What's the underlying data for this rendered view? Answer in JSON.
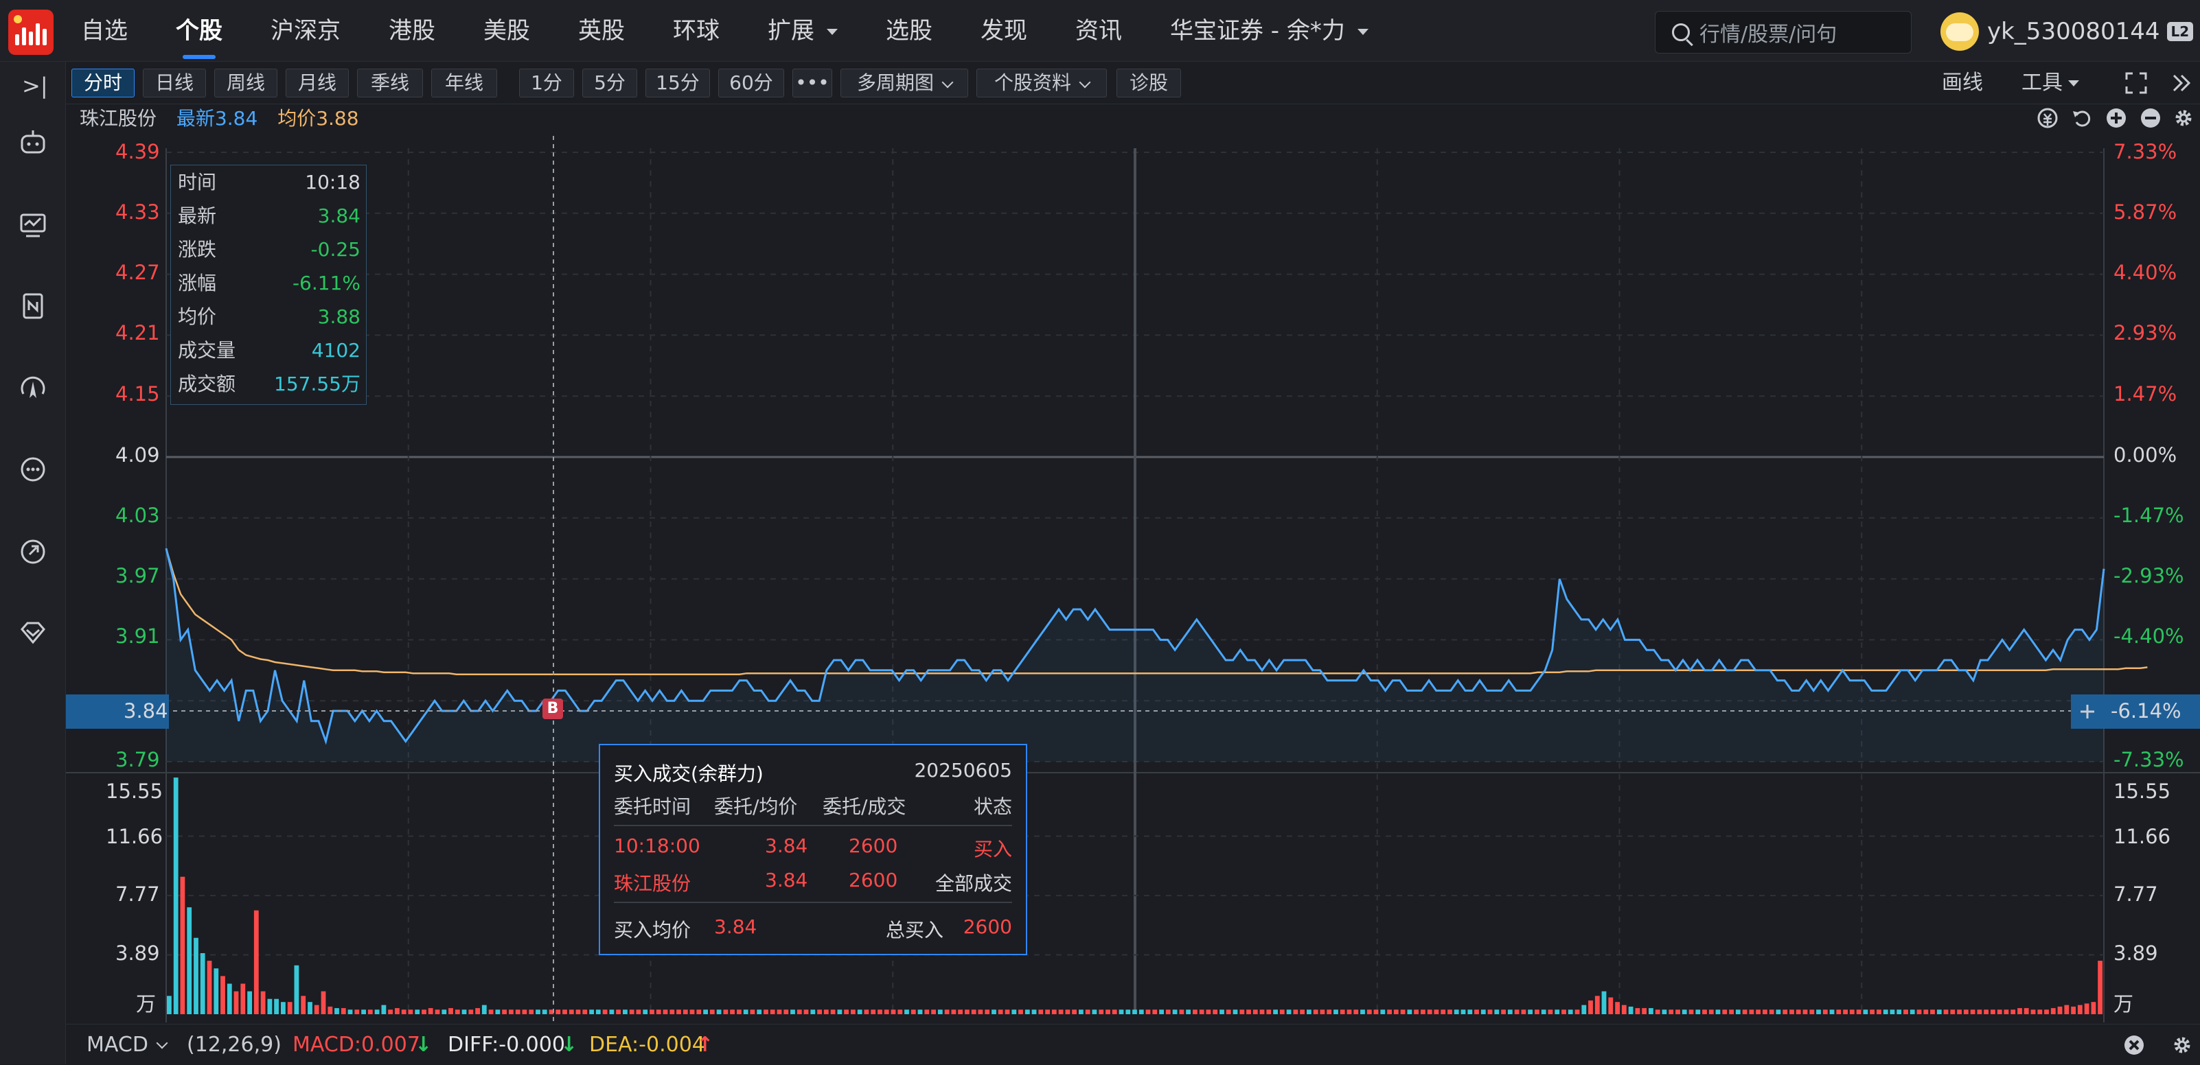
{
  "topbar": {
    "nav": [
      "自选",
      "个股",
      "沪深京",
      "港股",
      "美股",
      "英股",
      "环球",
      "扩展",
      "选股",
      "发现",
      "资讯",
      "华宝证券 - 余*力"
    ],
    "active_index": 1,
    "search_placeholder": "行情/股票/问句",
    "username": "yk_530080144",
    "level_badge": "L2"
  },
  "sidebar": {
    "collapse_symbol": ">|",
    "icons": [
      "robot-icon",
      "monitor-chart-icon",
      "news-icon",
      "compass-icon",
      "chat-icon",
      "link-icon",
      "diamond-icon"
    ]
  },
  "toolbar": {
    "periods": [
      "分时",
      "日线",
      "周线",
      "月线",
      "季线",
      "年线",
      "1分",
      "5分",
      "15分",
      "60分"
    ],
    "more": "•••",
    "dropdowns": [
      "多周期图",
      "个股资料"
    ],
    "diagnose": "诊股",
    "draw": "画线",
    "tools": "工具"
  },
  "stock": {
    "name": "珠江股份",
    "latest_label": "最新3.84",
    "avg_label": "均价3.88"
  },
  "data_panel": {
    "rows": [
      {
        "k": "时间",
        "v": "10:18",
        "color": "white"
      },
      {
        "k": "最新",
        "v": "3.84",
        "color": "green"
      },
      {
        "k": "涨跌",
        "v": "-0.25",
        "color": "green"
      },
      {
        "k": "涨幅",
        "v": "-6.11%",
        "color": "green"
      },
      {
        "k": "均价",
        "v": "3.88",
        "color": "green"
      },
      {
        "k": "成交量",
        "v": "4102",
        "color": "teal"
      },
      {
        "k": "成交额",
        "v": "157.55万",
        "color": "teal"
      }
    ]
  },
  "price_axis": {
    "left": [
      "4.39",
      "4.33",
      "4.27",
      "4.21",
      "4.15",
      "4.09",
      "4.03",
      "3.97",
      "3.91",
      "3.79"
    ],
    "right": [
      "7.33%",
      "5.87%",
      "4.40%",
      "2.93%",
      "1.47%",
      "0.00%",
      "-1.47%",
      "-2.93%",
      "-4.40%",
      "-7.33%"
    ],
    "pointer_left": "3.84",
    "pointer_right": "-6.14%"
  },
  "volume_axis": {
    "left": [
      "15.55",
      "11.66",
      "7.77",
      "3.89",
      "万"
    ],
    "right": [
      "15.55",
      "11.66",
      "7.77",
      "3.89",
      "万"
    ]
  },
  "trade_popup": {
    "title": "买入成交(余群力)",
    "date": "20250605",
    "headers": [
      "委托时间",
      "委托/均价",
      "委托/成交",
      "状态"
    ],
    "row1": [
      "10:18:00",
      "3.84",
      "2600",
      "买入"
    ],
    "row2": [
      "珠江股份",
      "3.84",
      "2600",
      "全部成交"
    ],
    "avg_label": "买入均价",
    "avg_value": "3.84",
    "total_label": "总买入",
    "total_value": "2600"
  },
  "trade_marker": "B",
  "macd": {
    "name": "MACD",
    "params": "(12,26,9)",
    "macd": "MACD:0.007",
    "diff": "DIFF:-0.000",
    "dea": "DEA:-0.004"
  },
  "colors": {
    "price_line": "#4aa8ff",
    "avg_line": "#f0b56a",
    "up": "#ff4a4a",
    "down": "#2bc45f",
    "accent": "#2f86ff"
  },
  "chart_data": {
    "type": "line",
    "ylim": [
      3.79,
      4.39
    ],
    "prev_close": 4.09,
    "series": [
      {
        "values": [
          4.0,
          3.97,
          3.91,
          3.92,
          3.88,
          3.87,
          3.86,
          3.87,
          3.86,
          3.87,
          3.83,
          3.86,
          3.86,
          3.83,
          3.84,
          3.88,
          3.85,
          3.84,
          3.83,
          3.87,
          3.83,
          3.83,
          3.81,
          3.84,
          3.84,
          3.84,
          3.83,
          3.84,
          3.83,
          3.84,
          3.83,
          3.83,
          3.82,
          3.81,
          3.82,
          3.83,
          3.84,
          3.85,
          3.84,
          3.84,
          3.84,
          3.85,
          3.84,
          3.84,
          3.85,
          3.84,
          3.85,
          3.86,
          3.85,
          3.85,
          3.84,
          3.84,
          3.85,
          3.85,
          3.86,
          3.86,
          3.85,
          3.84,
          3.84,
          3.85,
          3.85,
          3.86,
          3.87,
          3.87,
          3.86,
          3.85,
          3.86,
          3.85,
          3.86,
          3.85,
          3.85,
          3.86,
          3.85,
          3.85,
          3.85,
          3.86,
          3.86,
          3.86,
          3.86,
          3.87,
          3.87,
          3.86,
          3.86,
          3.85,
          3.85,
          3.86,
          3.87,
          3.86,
          3.86,
          3.85,
          3.85,
          3.88,
          3.89,
          3.89,
          3.88,
          3.89,
          3.89,
          3.88,
          3.88,
          3.88,
          3.88,
          3.87,
          3.88,
          3.88,
          3.87,
          3.88,
          3.88,
          3.88,
          3.88,
          3.89,
          3.89,
          3.88,
          3.88,
          3.87,
          3.88,
          3.88,
          3.87,
          3.88,
          3.89,
          3.9,
          3.91,
          3.92,
          3.93,
          3.94,
          3.93,
          3.94,
          3.94,
          3.93,
          3.94,
          3.93,
          3.92,
          3.92,
          3.92,
          3.92,
          3.92,
          3.92,
          3.92,
          3.91,
          3.91,
          3.9,
          3.91,
          3.92,
          3.93,
          3.92,
          3.91,
          3.9,
          3.89,
          3.89,
          3.9,
          3.89,
          3.89,
          3.88,
          3.89,
          3.88,
          3.89,
          3.89,
          3.89,
          3.89,
          3.88,
          3.88,
          3.87,
          3.87,
          3.87,
          3.87,
          3.87,
          3.88,
          3.87,
          3.87,
          3.86,
          3.87,
          3.87,
          3.86,
          3.86,
          3.86,
          3.87,
          3.86,
          3.86,
          3.86,
          3.87,
          3.86,
          3.86,
          3.87,
          3.86,
          3.86,
          3.86,
          3.87,
          3.86,
          3.86,
          3.86,
          3.87,
          3.88,
          3.9,
          3.97,
          3.95,
          3.94,
          3.93,
          3.93,
          3.92,
          3.93,
          3.92,
          3.93,
          3.91,
          3.91,
          3.91,
          3.9,
          3.9,
          3.89,
          3.89,
          3.88,
          3.89,
          3.88,
          3.89,
          3.88,
          3.88,
          3.89,
          3.88,
          3.88,
          3.89,
          3.89,
          3.88,
          3.88,
          3.88,
          3.87,
          3.87,
          3.86,
          3.86,
          3.87,
          3.86,
          3.87,
          3.86,
          3.87,
          3.88,
          3.87,
          3.87,
          3.87,
          3.86,
          3.86,
          3.86,
          3.87,
          3.88,
          3.88,
          3.87,
          3.88,
          3.88,
          3.88,
          3.89,
          3.89,
          3.88,
          3.88,
          3.87,
          3.89,
          3.89,
          3.9,
          3.91,
          3.9,
          3.91,
          3.92,
          3.91,
          3.9,
          3.89,
          3.9,
          3.89,
          3.91,
          3.92,
          3.92,
          3.91,
          3.92,
          3.98
        ]
      },
      {
        "values": [
          4.0,
          3.975,
          3.955,
          3.945,
          3.935,
          3.93,
          3.925,
          3.92,
          3.915,
          3.91,
          3.9,
          3.895,
          3.893,
          3.891,
          3.89,
          3.888,
          3.887,
          3.886,
          3.885,
          3.884,
          3.883,
          3.882,
          3.881,
          3.88,
          3.88,
          3.88,
          3.88,
          3.879,
          3.879,
          3.879,
          3.878,
          3.878,
          3.878,
          3.878,
          3.877,
          3.877,
          3.877,
          3.877,
          3.877,
          3.877,
          3.876,
          3.876,
          3.876,
          3.876,
          3.876,
          3.876,
          3.876,
          3.876,
          3.876,
          3.876,
          3.876,
          3.876,
          3.876,
          3.876,
          3.876,
          3.876,
          3.876,
          3.876,
          3.876,
          3.876,
          3.876,
          3.876,
          3.876,
          3.876,
          3.876,
          3.876,
          3.876,
          3.876,
          3.876,
          3.876,
          3.876,
          3.876,
          3.876,
          3.876,
          3.876,
          3.876,
          3.876,
          3.876,
          3.876,
          3.876,
          3.877,
          3.877,
          3.877,
          3.877,
          3.877,
          3.877,
          3.877,
          3.877,
          3.877,
          3.877,
          3.877,
          3.877,
          3.877,
          3.877,
          3.877,
          3.877,
          3.877,
          3.877,
          3.877,
          3.877,
          3.877,
          3.877,
          3.877,
          3.877,
          3.877,
          3.877,
          3.877,
          3.877,
          3.877,
          3.877,
          3.877,
          3.877,
          3.877,
          3.877,
          3.877,
          3.877,
          3.877,
          3.877,
          3.877,
          3.877,
          3.877,
          3.877,
          3.877,
          3.877,
          3.877,
          3.877,
          3.877,
          3.877,
          3.877,
          3.877,
          3.877,
          3.877,
          3.877,
          3.877,
          3.877,
          3.877,
          3.877,
          3.877,
          3.877,
          3.877,
          3.877,
          3.877,
          3.877,
          3.877,
          3.877,
          3.877,
          3.877,
          3.877,
          3.877,
          3.877,
          3.877,
          3.877,
          3.877,
          3.877,
          3.877,
          3.877,
          3.877,
          3.877,
          3.877,
          3.877,
          3.877,
          3.877,
          3.877,
          3.877,
          3.877,
          3.877,
          3.877,
          3.877,
          3.877,
          3.877,
          3.877,
          3.877,
          3.877,
          3.877,
          3.877,
          3.877,
          3.877,
          3.877,
          3.877,
          3.877,
          3.877,
          3.877,
          3.877,
          3.877,
          3.877,
          3.877,
          3.877,
          3.877,
          3.877,
          3.878,
          3.878,
          3.878,
          3.878,
          3.879,
          3.879,
          3.879,
          3.879,
          3.88,
          3.88,
          3.88,
          3.88,
          3.88,
          3.88,
          3.88,
          3.88,
          3.88,
          3.88,
          3.88,
          3.88,
          3.88,
          3.88,
          3.88,
          3.88,
          3.88,
          3.88,
          3.88,
          3.88,
          3.88,
          3.88,
          3.88,
          3.88,
          3.88,
          3.88,
          3.88,
          3.88,
          3.88,
          3.88,
          3.88,
          3.88,
          3.88,
          3.88,
          3.88,
          3.88,
          3.88,
          3.88,
          3.88,
          3.88,
          3.88,
          3.88,
          3.88,
          3.88,
          3.88,
          3.88,
          3.88,
          3.88,
          3.88,
          3.88,
          3.88,
          3.88,
          3.88,
          3.88,
          3.88,
          3.88,
          3.88,
          3.88,
          3.88,
          3.88,
          3.88,
          3.88,
          3.88,
          3.881,
          3.881,
          3.881,
          3.881,
          3.881,
          3.881,
          3.881,
          3.881,
          3.881,
          3.881,
          3.882,
          3.882,
          3.882,
          3.883
        ]
      }
    ],
    "volume_ylim": [
      0,
      15.55
    ],
    "volume": [
      1.2,
      15.5,
      9,
      7,
      5,
      4,
      3.5,
      3,
      2.5,
      2,
      1.5,
      2,
      1.5,
      6.8,
      1.5,
      1,
      1,
      0.8,
      0.8,
      3.2,
      1.2,
      0.8,
      0.6,
      1.5,
      0.5,
      0.4,
      0.4,
      0.3,
      0.3,
      0.3,
      0.3,
      0.3,
      0.6,
      0.3,
      0.4,
      0.3,
      0.3,
      0.3,
      0.3,
      0.4,
      0.3,
      0.3,
      0.4,
      0.3,
      0.3,
      0.3,
      0.4,
      0.6,
      0.3,
      0.3,
      0.3,
      0.3,
      0.3,
      0.3,
      0.3,
      0.3,
      0.3,
      0.3,
      0.3,
      0.3,
      0.3,
      0.3,
      0.3,
      0.3,
      0.3,
      0.3,
      0.3,
      0.3,
      0.3,
      0.3,
      0.3,
      0.3,
      0.3,
      0.3,
      0.3,
      0.3,
      0.3,
      0.3,
      0.3,
      0.3,
      0.3,
      0.3,
      0.3,
      0.3,
      0.3,
      0.3,
      0.3,
      0.3,
      0.3,
      0.3,
      0.3,
      0.3,
      0.3,
      0.3,
      0.3,
      0.3,
      0.3,
      0.3,
      0.3,
      0.3,
      0.3,
      0.3,
      0.3,
      0.3,
      0.3,
      0.3,
      0.3,
      0.3,
      0.3,
      0.3,
      0.3,
      0.3,
      0.3,
      0.3,
      0.3,
      0.3,
      0.3,
      0.3,
      0.3,
      0.3,
      0.3,
      0.3,
      0.3,
      0.3,
      0.3,
      0.3,
      0.3,
      0.3,
      0.3,
      0.3,
      0.3,
      0.3,
      0.3,
      0.3,
      0.3,
      0.3,
      0.3,
      0.3,
      0.3,
      0.3,
      0.3,
      0.3,
      0.3,
      0.3,
      0.3,
      0.3,
      0.3,
      0.3,
      0.3,
      0.3,
      0.3,
      0.3,
      0.3,
      0.3,
      0.3,
      0.3,
      0.3,
      0.3,
      0.3,
      0.3,
      0.3,
      0.3,
      0.3,
      0.3,
      0.3,
      0.3,
      0.3,
      0.3,
      0.3,
      0.3,
      0.3,
      0.3,
      0.3,
      0.3,
      0.3,
      0.3,
      0.3,
      0.3,
      0.3,
      0.3,
      0.3,
      0.3,
      0.3,
      0.3,
      0.3,
      0.3,
      0.3,
      0.3,
      0.3,
      0.3,
      0.3,
      0.3,
      0.3,
      0.3,
      0.3,
      0.3,
      0.3,
      0.3,
      0.3,
      0.3,
      0.3,
      0.3,
      0.3,
      0.3,
      0.3,
      0.3,
      0.3,
      0.3,
      0.3,
      0.3,
      0.3,
      0.6,
      0.9,
      1.2,
      1.5,
      1.1,
      0.8,
      0.6,
      0.5,
      0.4,
      0.4,
      0.4,
      0.3,
      0.3,
      0.3,
      0.3,
      0.3,
      0.3,
      0.3,
      0.3,
      0.3,
      0.3,
      0.3,
      0.3,
      0.3,
      0.3,
      0.3,
      0.3,
      0.3,
      0.3,
      0.3,
      0.3,
      0.3,
      0.3,
      0.3,
      0.3,
      0.3,
      0.3,
      0.3,
      0.3,
      0.3,
      0.3,
      0.3,
      0.3,
      0.3,
      0.3,
      0.3,
      0.3,
      0.3,
      0.3,
      0.3,
      0.3,
      0.3,
      0.3,
      0.3,
      0.3,
      0.3,
      0.3,
      0.3,
      0.3,
      0.3,
      0.3,
      0.3,
      0.3,
      0.3,
      0.3,
      0.4,
      0.4,
      0.3,
      0.3,
      0.3,
      0.4,
      0.5,
      0.6,
      0.5,
      0.6,
      0.7,
      0.8,
      3.5
    ]
  }
}
